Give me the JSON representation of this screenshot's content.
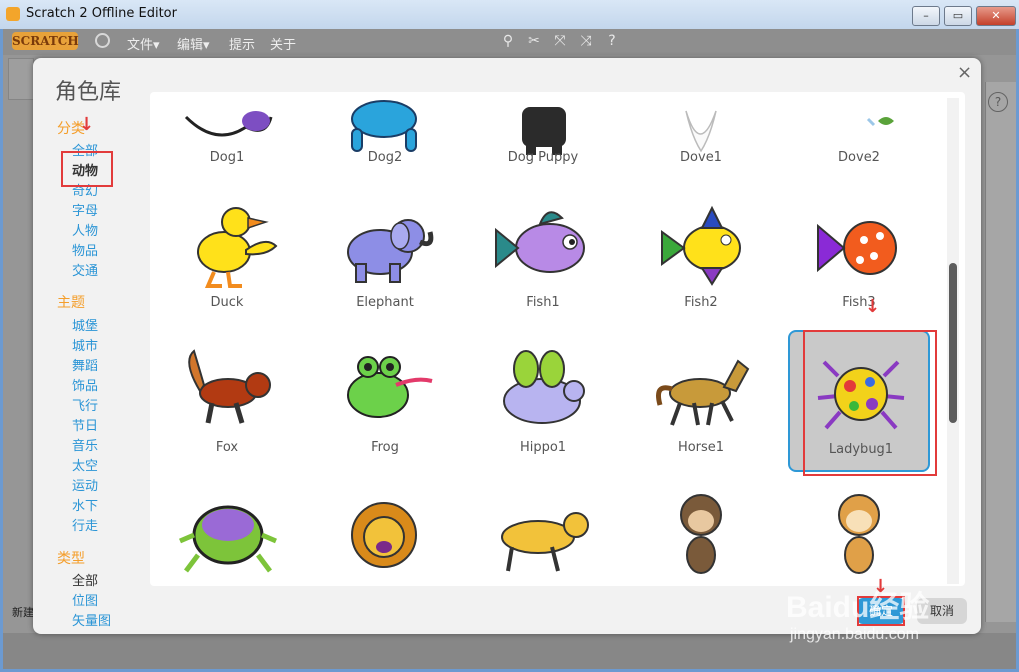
{
  "window": {
    "title": "Scratch 2 Offline Editor",
    "minimize": "–",
    "maximize": "▭",
    "close": "✕"
  },
  "menubar": {
    "logo": "SCRATCH",
    "file": "文件▾",
    "edit": "编辑▾",
    "tips": "提示",
    "about": "关于"
  },
  "app": {
    "new_label": "新建"
  },
  "dialog": {
    "title": "角色库",
    "close": "×",
    "category_head": "分类",
    "categories": [
      "全部",
      "动物",
      "奇幻",
      "字母",
      "人物",
      "物品",
      "交通"
    ],
    "theme_head": "主题",
    "themes": [
      "城堡",
      "城市",
      "舞蹈",
      "饰品",
      "飞行",
      "节日",
      "音乐",
      "太空",
      "运动",
      "水下",
      "行走"
    ],
    "type_head": "类型",
    "types": [
      "全部",
      "位图",
      "矢量图"
    ],
    "sprites_row1": [
      "Dog1",
      "Dog2",
      "Dog Puppy",
      "Dove1",
      "Dove2"
    ],
    "sprites_row2": [
      "Duck",
      "Elephant",
      "Fish1",
      "Fish2",
      "Fish3"
    ],
    "sprites_row3": [
      "Fox",
      "Frog",
      "Hippo1",
      "Horse1",
      "Ladybug1"
    ],
    "ok": "确定",
    "cancel": "取消"
  },
  "watermark": {
    "line1": "Baidu经验",
    "line2": "jingyan.baidu.com"
  },
  "colors": {
    "accent": "#2e98d6",
    "category": "#f49e2b",
    "annotation": "#e23b3b"
  }
}
